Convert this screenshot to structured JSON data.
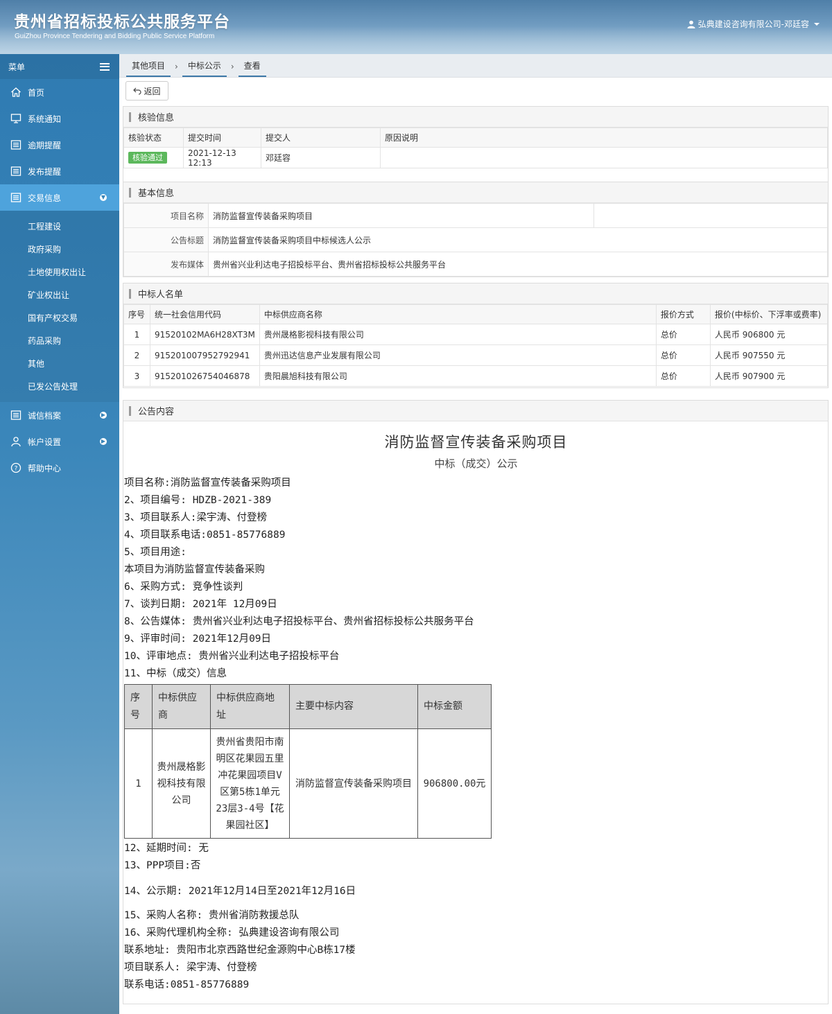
{
  "header": {
    "title": "贵州省招标投标公共服务平台",
    "subtitle": "GuiZhou Province Tendering and Bidding Public Service Platform",
    "user": "弘典建设咨询有限公司-邓廷容"
  },
  "sidebar": {
    "menu_label": "菜单",
    "items": [
      {
        "label": "首页",
        "icon": "home-icon"
      },
      {
        "label": "系统通知",
        "icon": "monitor-icon"
      },
      {
        "label": "逾期提醒",
        "icon": "list-icon"
      },
      {
        "label": "发布提醒",
        "icon": "list-icon"
      },
      {
        "label": "交易信息",
        "icon": "list-icon"
      }
    ],
    "sub_items": [
      "工程建设",
      "政府采购",
      "土地使用权出让",
      "矿业权出让",
      "国有产权交易",
      "药品采购",
      "其他",
      "已发公告处理"
    ],
    "bottom_items": [
      {
        "label": "诚信档案",
        "icon": "list-icon"
      },
      {
        "label": "帐户设置",
        "icon": "user-icon"
      },
      {
        "label": "帮助中心",
        "icon": "help-icon"
      }
    ]
  },
  "breadcrumb": [
    "其他项目",
    "中标公示",
    "查看"
  ],
  "back_label": "返回",
  "verify": {
    "title": "核验信息",
    "headers": [
      "核验状态",
      "提交时间",
      "提交人",
      "原因说明"
    ],
    "status": "核验通过",
    "time": "2021-12-13 12:13",
    "submitter": "邓廷容",
    "reason": ""
  },
  "basic": {
    "title": "基本信息",
    "rows": [
      {
        "k": "项目名称",
        "v": "消防监督宣传装备采购项目"
      },
      {
        "k": "公告标题",
        "v": "消防监督宣传装备采购项目中标候选人公示"
      },
      {
        "k": "发布媒体",
        "v": "贵州省兴业利达电子招投标平台、贵州省招标投标公共服务平台"
      }
    ]
  },
  "winners": {
    "title": "中标人名单",
    "headers": [
      "序号",
      "统一社会信用代码",
      "中标供应商名称",
      "报价方式",
      "报价(中标价、下浮率或费率)"
    ],
    "rows": [
      [
        "1",
        "91520102MA6H28XT3M",
        "贵州晟格影视科技有限公司",
        "总价",
        "人民币 906800 元"
      ],
      [
        "2",
        "915201007952792941",
        "贵州迅达信息产业发展有限公司",
        "总价",
        "人民币 907550 元"
      ],
      [
        "3",
        "915201026754046878",
        "贵阳晨旭科技有限公司",
        "总价",
        "人民币 907900 元"
      ]
    ]
  },
  "notice": {
    "title": "公告内容",
    "doc_title": "消防监督宣传装备采购项目",
    "doc_sub": "中标（成交）公示",
    "lines_a": [
      "项目名称:消防监督宣传装备采购项目",
      "2、项目编号: HDZB-2021-389",
      "3、项目联系人:梁宇涛、付登榜",
      "4、项目联系电话:0851-85776889",
      "5、项目用途:",
      "本项目为消防监督宣传装备采购",
      "6、采购方式: 竞争性谈判",
      "7、谈判日期: 2021年 12月09日",
      "8、公告媒体: 贵州省兴业利达电子招投标平台、贵州省招标投标公共服务平台",
      "9、评审时间: 2021年12月09日",
      "10、评审地点: 贵州省兴业利达电子招投标平台",
      "11、中标（成交）信息"
    ],
    "table_headers": [
      "序号",
      "中标供应商",
      "中标供应商地址",
      "主要中标内容",
      "中标金额"
    ],
    "table_row": [
      "1",
      "贵州晟格影视科技有限公司",
      "贵州省贵阳市南明区花果园五里冲花果园项目V区第5栋1单元23层3-4号【花果园社区】",
      "消防监督宣传装备采购项目",
      "906800.00元"
    ],
    "lines_b": [
      "12、延期时间: 无",
      "13、PPP项目:否"
    ],
    "line_c": "14、公示期: 2021年12月14日至2021年12月16日",
    "lines_d": [
      "15、采购人名称: 贵州省消防救援总队",
      "16、采购代理机构全称: 弘典建设咨询有限公司",
      "联系地址: 贵阳市北京西路世纪金源购中心B栋17楼",
      "项目联系人: 梁宇涛、付登榜",
      "联系电话:0851-85776889"
    ]
  }
}
